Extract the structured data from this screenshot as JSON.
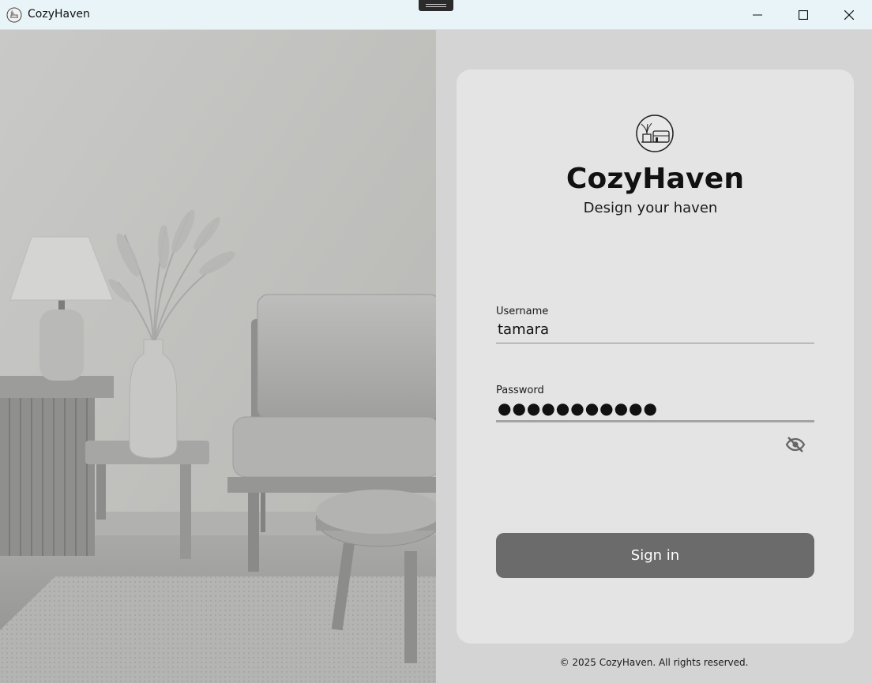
{
  "window": {
    "title": "CozyHaven",
    "app_icon": "cozyhaven-logo-icon",
    "controls": [
      "minimize-icon",
      "maximize-icon",
      "close-icon"
    ]
  },
  "hero_image": {
    "subject": "grayscale living room with lamp, pampas vase, sofa and coffee table"
  },
  "login": {
    "logo_icon": "cozyhaven-logo-icon",
    "brand": "CozyHaven",
    "tagline": "Design your haven",
    "username": {
      "label": "Username",
      "value": "tamara"
    },
    "password": {
      "label": "Password",
      "value": "●●●●●●●●●●●",
      "toggle_icon": "eye-off-icon"
    },
    "signin_label": "Sign in"
  },
  "footer": {
    "text": "© 2025 CozyHaven. All rights reserved."
  },
  "colors": {
    "titlebar": "#e8f4f7",
    "panel_bg": "#d4d4d4",
    "card_bg": "#e4e4e4",
    "button_bg": "#6b6b6b",
    "button_text": "#ffffff"
  }
}
